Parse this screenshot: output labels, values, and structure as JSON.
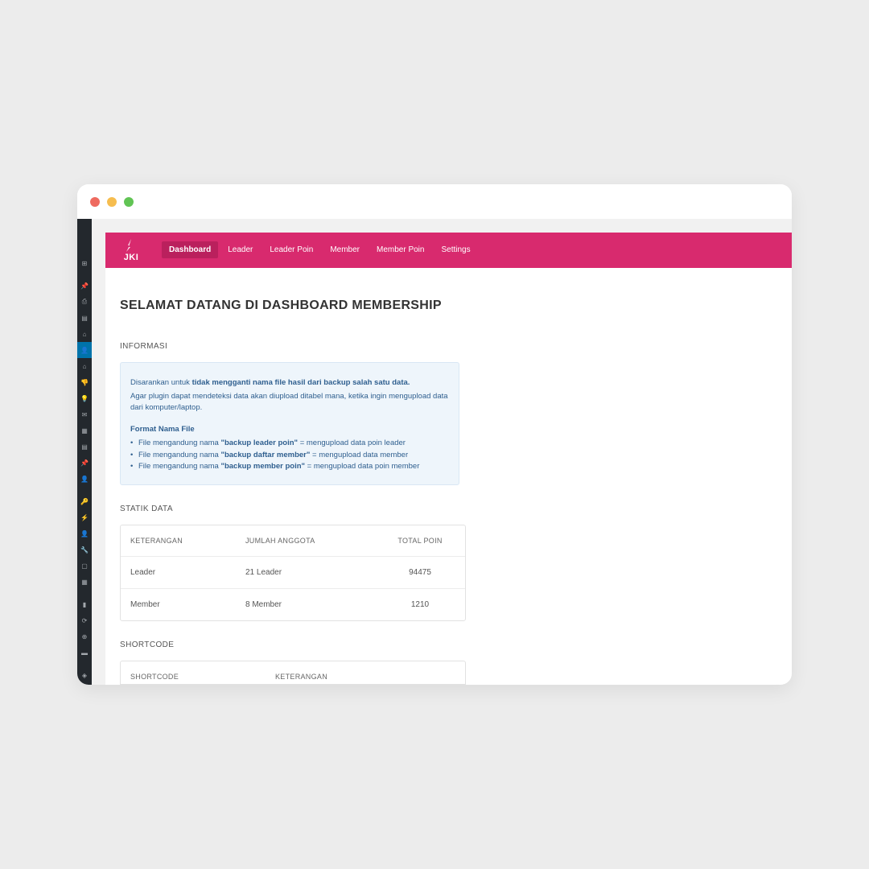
{
  "logo_text": "JKI",
  "tabs": [
    {
      "label": "Dashboard",
      "active": true
    },
    {
      "label": "Leader",
      "active": false
    },
    {
      "label": "Leader Poin",
      "active": false
    },
    {
      "label": "Member",
      "active": false
    },
    {
      "label": "Member Poin",
      "active": false
    },
    {
      "label": "Settings",
      "active": false
    }
  ],
  "page_title": "SELAMAT DATANG DI DASHBOARD MEMBERSHIP",
  "section_info_title": "INFORMASI",
  "info": {
    "line1_prefix": "Disarankan untuk ",
    "line1_bold": "tidak mengganti nama file hasil dari backup salah satu data.",
    "line2": "Agar plugin dapat mendeteksi data akan diupload ditabel mana, ketika ingin mengupload data dari komputer/laptop.",
    "format_title": "Format Nama File",
    "items": [
      {
        "pre": "File mengandung nama ",
        "bold": "\"backup leader poin\"",
        "post": " = mengupload data poin leader"
      },
      {
        "pre": "File mengandung nama ",
        "bold": "\"backup daftar member\"",
        "post": " = mengupload data member"
      },
      {
        "pre": "File mengandung nama ",
        "bold": "\"backup member poin\"",
        "post": " = mengupload data poin member"
      }
    ]
  },
  "section_static_title": "STATIK DATA",
  "static_table": {
    "headers": [
      "KETERANGAN",
      "JUMLAH ANGGOTA",
      "TOTAL POIN"
    ],
    "rows": [
      {
        "keterangan": "Leader",
        "jumlah": "21 Leader",
        "poin": "94475"
      },
      {
        "keterangan": "Member",
        "jumlah": "8 Member",
        "poin": "1210"
      }
    ]
  },
  "section_shortcode_title": "SHORTCODE",
  "shortcode_headers": [
    "SHORTCODE",
    "KETERANGAN"
  ]
}
